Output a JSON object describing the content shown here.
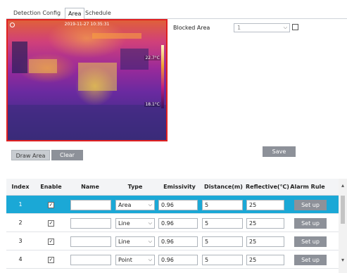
{
  "tabs": [
    {
      "label": "Detection Config"
    },
    {
      "label": "Area",
      "active": true
    },
    {
      "label": "Schedule"
    }
  ],
  "preview": {
    "timestamp": "2019-11-27 10:35:31",
    "temps": [
      "22.7°C",
      "18.1°C"
    ]
  },
  "buttons": {
    "draw_area": "Draw Area",
    "clear": "Clear",
    "save": "Save"
  },
  "blocked_area": {
    "label": "Blocked Area",
    "selected": "1",
    "checked": false
  },
  "table": {
    "headers": [
      "Index",
      "Enable",
      "Name",
      "Type",
      "Emissivity",
      "Distance(m)",
      "Reflective(℃)",
      "Alarm Rule"
    ],
    "rows": [
      {
        "index": "1",
        "enable": true,
        "name": "",
        "type": "Area",
        "emissivity": "0.96",
        "distance": "5",
        "reflective": "25",
        "rule": "Set up",
        "selected": true
      },
      {
        "index": "2",
        "enable": true,
        "name": "",
        "type": "Line",
        "emissivity": "0.96",
        "distance": "5",
        "reflective": "25",
        "rule": "Set up",
        "selected": false
      },
      {
        "index": "3",
        "enable": true,
        "name": "",
        "type": "Line",
        "emissivity": "0.96",
        "distance": "5",
        "reflective": "25",
        "rule": "Set up",
        "selected": false
      },
      {
        "index": "4",
        "enable": true,
        "name": "",
        "type": "Point",
        "emissivity": "0.96",
        "distance": "5",
        "reflective": "25",
        "rule": "Set up",
        "selected": false
      }
    ]
  },
  "colors": {
    "selected_row": "#1ba8d6",
    "button_gray": "#8d9199",
    "image_border": "#e02020"
  }
}
